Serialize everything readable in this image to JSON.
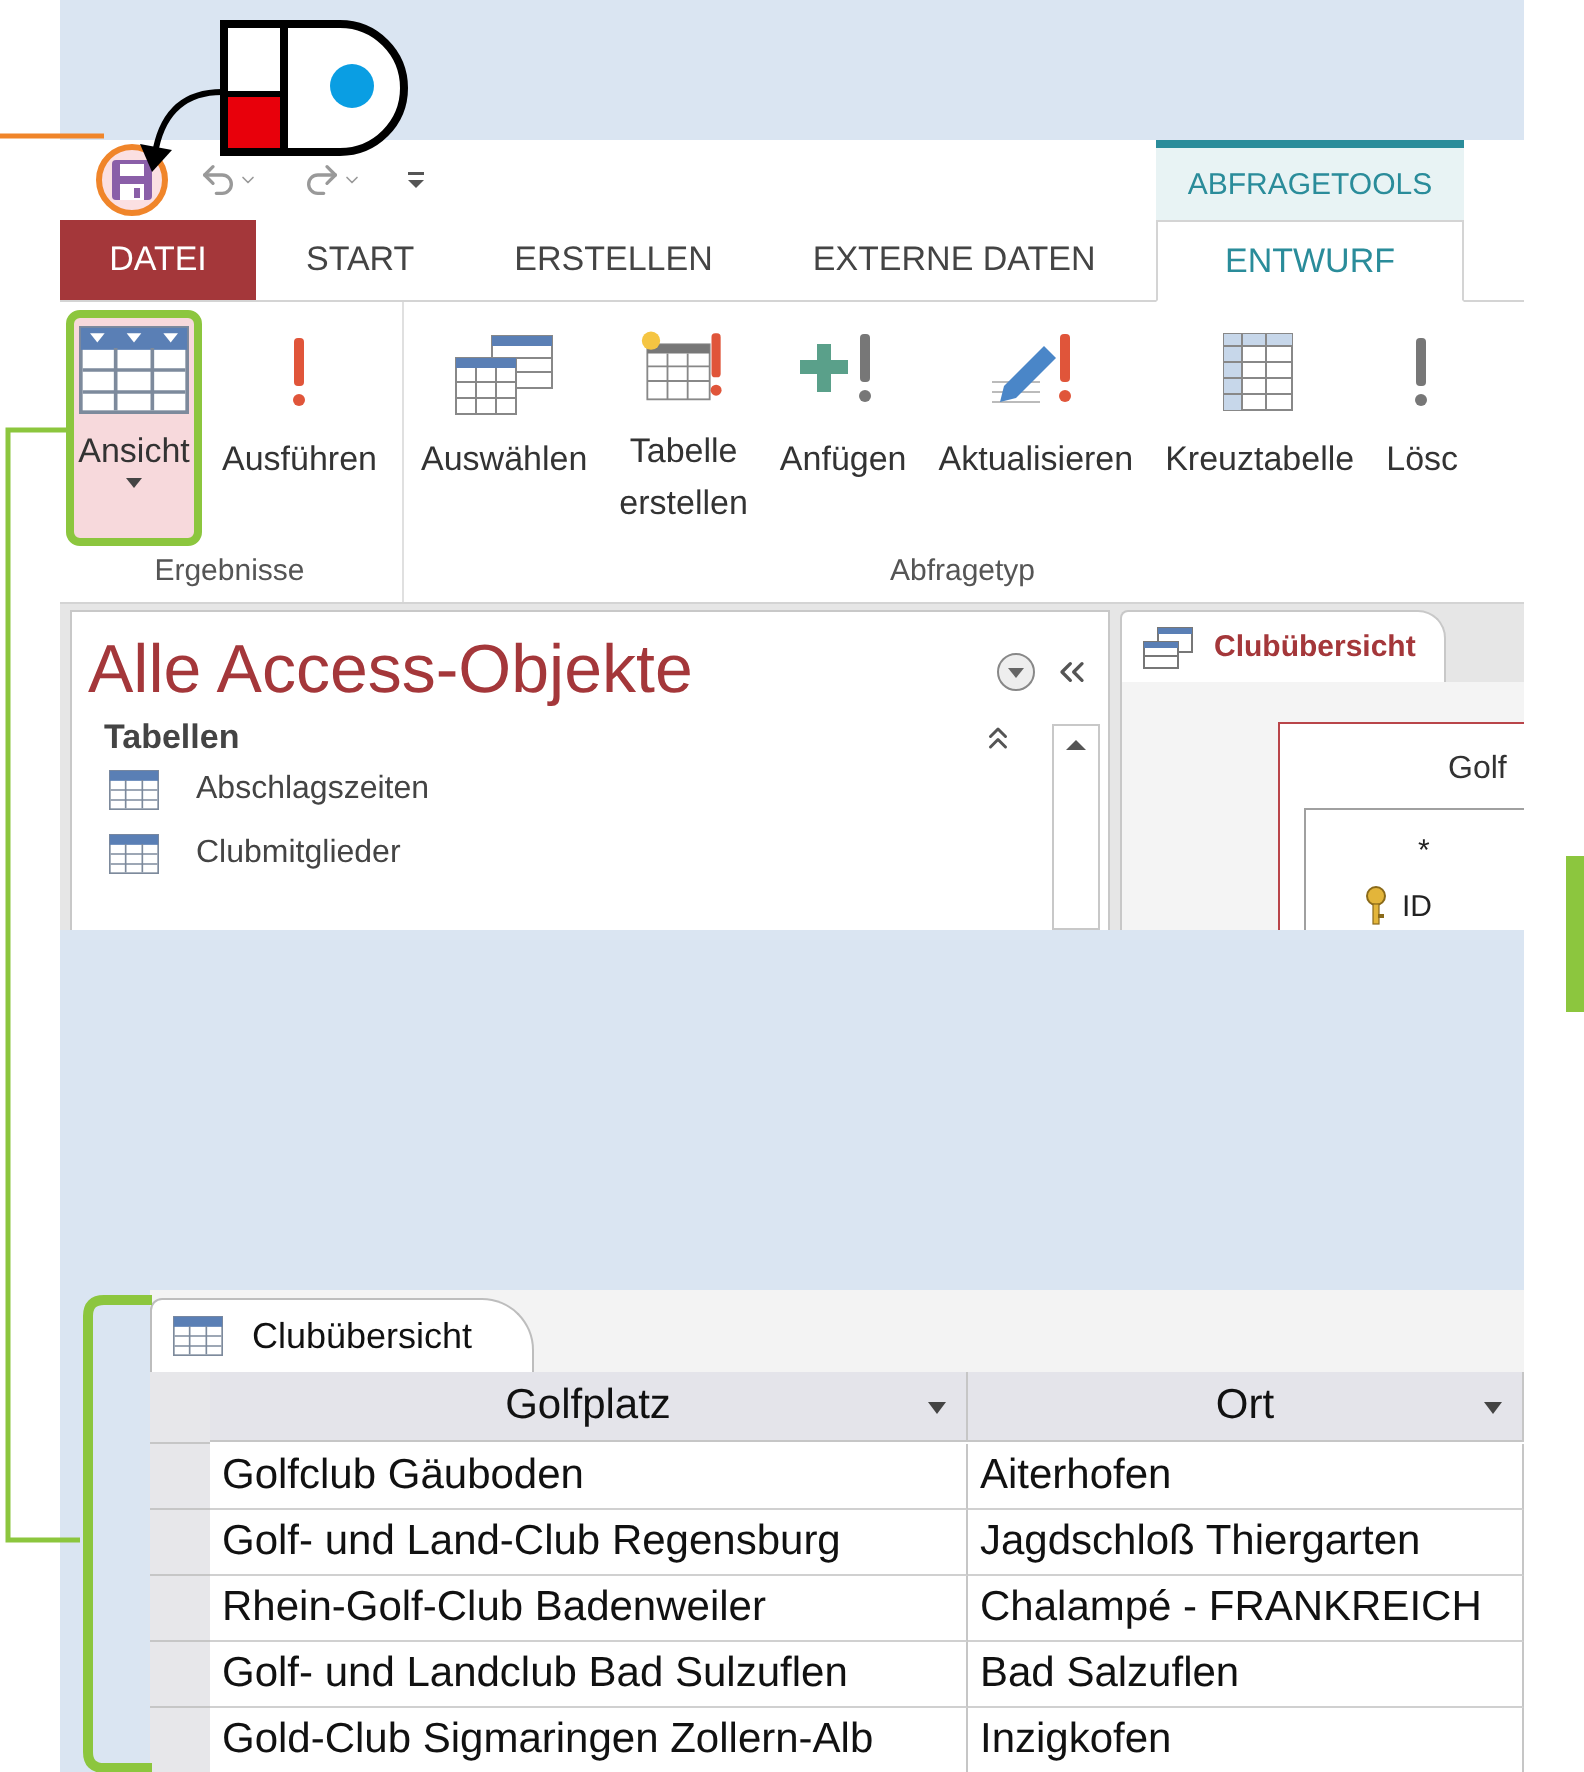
{
  "quick_access": {
    "buttons": [
      {
        "kind": "save",
        "marked": true
      },
      {
        "kind": "undo"
      },
      {
        "kind": "redo"
      },
      {
        "kind": "customize"
      }
    ]
  },
  "contextual_tab": "ABFRAGETOOLS",
  "tabs": [
    {
      "label": "DATEI",
      "kind": "file",
      "selected": false
    },
    {
      "label": "START",
      "kind": "normal",
      "selected": false
    },
    {
      "label": "ERSTELLEN",
      "kind": "normal",
      "selected": false
    },
    {
      "label": "EXTERNE DATEN",
      "kind": "normal",
      "selected": false
    },
    {
      "label": "ENTWURF",
      "kind": "context",
      "selected": true
    }
  ],
  "ribbon": {
    "groups": [
      {
        "label": "Ergebnisse",
        "buttons": [
          {
            "label": "Ansicht",
            "kind": "view",
            "dropdown": true,
            "marked": true
          },
          {
            "label": "Ausführen",
            "kind": "run",
            "dropdown": false,
            "marked": false
          }
        ]
      },
      {
        "label": "Abfragetyp",
        "buttons": [
          {
            "label": "Auswählen",
            "kind": "select",
            "dropdown": false,
            "marked": false
          },
          {
            "label": "Tabelle erstellen",
            "kind": "make_table",
            "dropdown": false,
            "marked": false
          },
          {
            "label": "Anfügen",
            "kind": "append",
            "dropdown": false,
            "marked": false
          },
          {
            "label": "Aktualisieren",
            "kind": "update",
            "dropdown": false,
            "marked": false
          },
          {
            "label": "Kreuztabelle",
            "kind": "crosstab",
            "dropdown": false,
            "marked": false
          },
          {
            "label": "Lösc",
            "kind": "delete",
            "dropdown": false,
            "marked": false
          }
        ]
      }
    ]
  },
  "nav_pane": {
    "title": "Alle Access-Objekte",
    "section": "Tabellen",
    "items": [
      "Abschlagszeiten",
      "Clubmitglieder"
    ]
  },
  "query_tab": {
    "label": "Clubübersicht"
  },
  "design_table": {
    "title": "Golf",
    "fields": [
      {
        "name": "*",
        "key": false
      },
      {
        "name": "ID",
        "key": true
      }
    ]
  },
  "datasheet": {
    "tab": "Clubübersicht",
    "marked": true,
    "columns": [
      "Golfplatz",
      "Ort"
    ],
    "rows": [
      [
        "Golfclub Gäuboden",
        "Aiterhofen"
      ],
      [
        "Golf- und Land-Club Regensburg",
        "Jagdschloß Thiergarten"
      ],
      [
        "Rhein-Golf-Club Badenweiler",
        "Chalampé - FRANKREICH"
      ],
      [
        "Golf- und Landclub Bad Sulzuflen",
        "Bad Salzuflen"
      ],
      [
        "Gold-Club Sigmaringen Zollern-Alb",
        "Inzigkofen"
      ]
    ]
  }
}
